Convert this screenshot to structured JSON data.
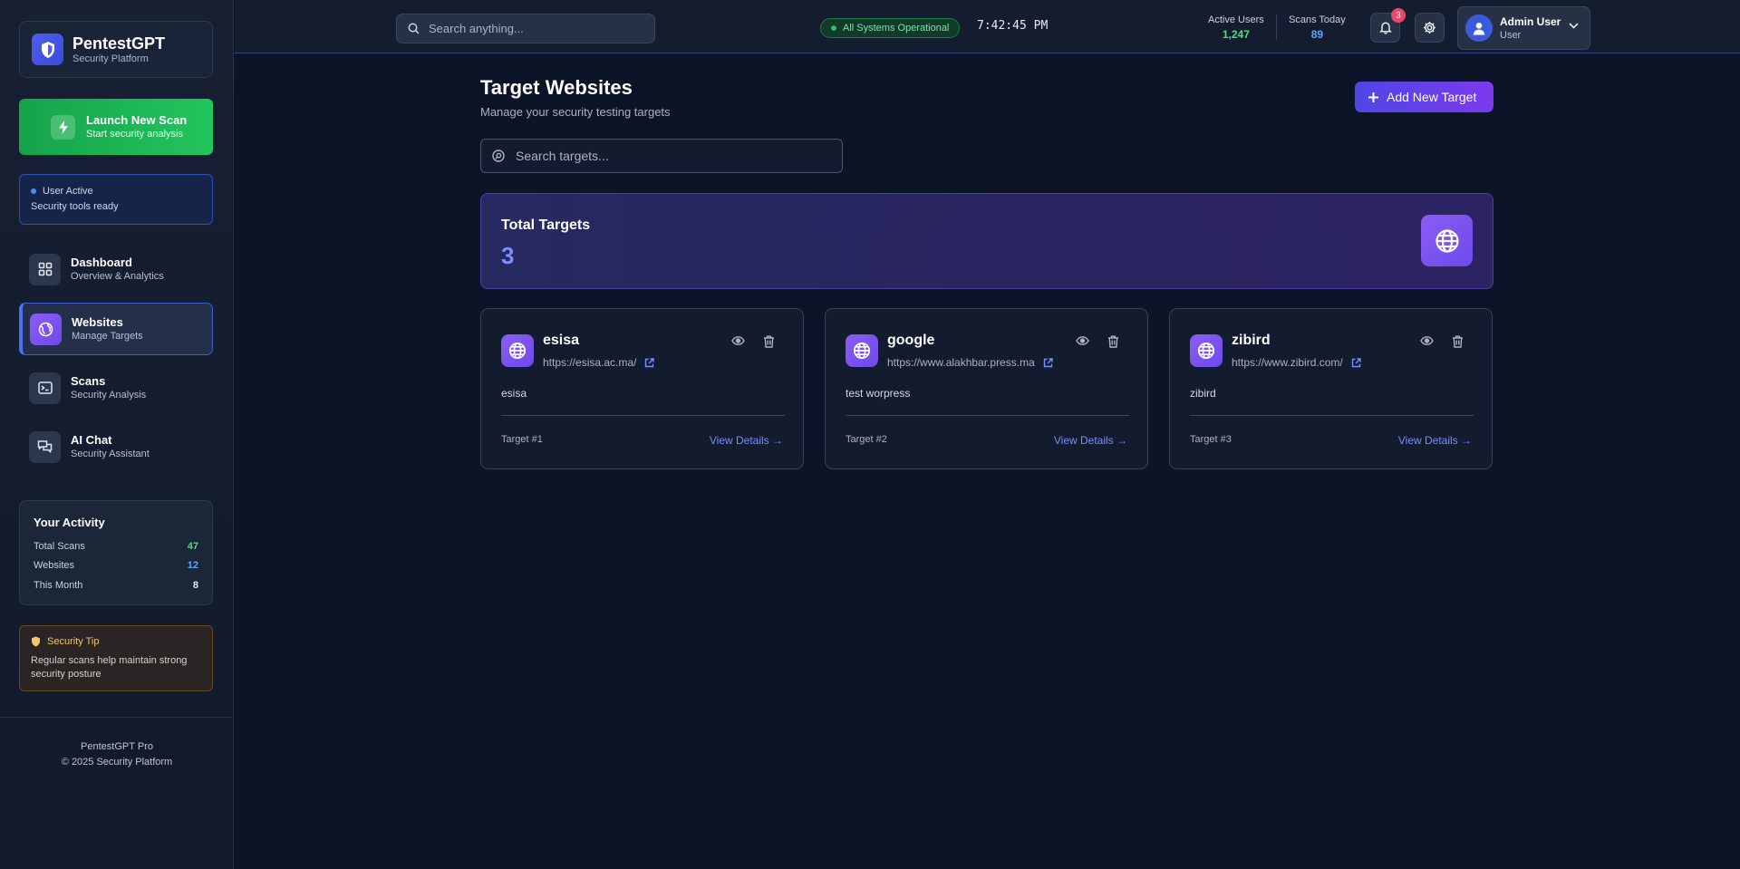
{
  "brand": {
    "title": "PentestGPT",
    "subtitle": "Security Platform"
  },
  "launch": {
    "title": "Launch New Scan",
    "subtitle": "Start security analysis"
  },
  "user_status": {
    "title": "User Active",
    "subtitle": "Security tools ready"
  },
  "nav": [
    {
      "title": "Dashboard",
      "subtitle": "Overview & Analytics",
      "icon": "grid-icon",
      "active": false
    },
    {
      "title": "Websites",
      "subtitle": "Manage Targets",
      "icon": "globe-icon",
      "active": true
    },
    {
      "title": "Scans",
      "subtitle": "Security Analysis",
      "icon": "terminal-icon",
      "active": false
    },
    {
      "title": "AI Chat",
      "subtitle": "Security Assistant",
      "icon": "chat-icon",
      "active": false
    }
  ],
  "activity": {
    "title": "Your Activity",
    "rows": [
      {
        "label": "Total Scans",
        "value": "47",
        "color": "#4ade80"
      },
      {
        "label": "Websites",
        "value": "12",
        "color": "#60a5fa"
      },
      {
        "label": "This Month",
        "value": "8",
        "color": "#e5e9f2"
      }
    ]
  },
  "tip": {
    "title": "Security Tip",
    "text": "Regular scans help maintain strong security posture"
  },
  "footer": {
    "line1": "PentestGPT Pro",
    "line2": "© 2025 Security Platform"
  },
  "header": {
    "search_placeholder": "Search anything...",
    "status": "All Systems Operational",
    "clock": "7:42:45 PM",
    "active_users_label": "Active Users",
    "active_users_value": "1,247",
    "scans_today_label": "Scans Today",
    "scans_today_value": "89",
    "notifications": "3",
    "user_name": "Admin User",
    "user_role": "User"
  },
  "page": {
    "title": "Target Websites",
    "subtitle": "Manage your security testing targets",
    "add_button": "Add New Target",
    "search_placeholder": "Search targets...",
    "total_label": "Total Targets",
    "total_value": "3"
  },
  "targets": [
    {
      "name": "esisa",
      "url": "https://esisa.ac.ma/",
      "description": "esisa",
      "number": "Target #1",
      "link": "View Details →"
    },
    {
      "name": "google",
      "url": "https://www.alakhbar.press.ma",
      "description": "test worpress",
      "number": "Target #2",
      "link": "View Details →"
    },
    {
      "name": "zibird",
      "url": "https://www.zibird.com/",
      "description": "zibird",
      "number": "Target #3",
      "link": "View Details →"
    }
  ],
  "colors": {
    "accent": "#4f46e5",
    "success": "#22c55e",
    "purple": "#8b5cf6",
    "badge": "#ef4468"
  }
}
